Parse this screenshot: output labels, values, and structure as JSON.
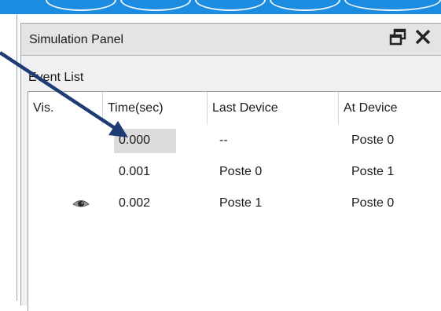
{
  "panel": {
    "title": "Simulation Panel",
    "restore_icon": "restore-window-icon",
    "close_icon": "close-icon"
  },
  "event_list": {
    "label": "Event List",
    "columns": [
      "Vis.",
      "Time(sec)",
      "Last Device",
      "At Device"
    ],
    "rows": [
      {
        "vis": "",
        "time": "0.000",
        "last_device": "--",
        "at_device": "Poste 0",
        "selected": true
      },
      {
        "vis": "",
        "time": "0.001",
        "last_device": "Poste 0",
        "at_device": "Poste 1",
        "selected": false
      },
      {
        "vis": "eye-icon",
        "time": "0.002",
        "last_device": "Poste 1",
        "at_device": "Poste 0",
        "selected": false
      }
    ]
  },
  "colors": {
    "accent_blue": "#1c8ce0",
    "arrow": "#1f3b73",
    "highlight": "#dcdcdc"
  }
}
